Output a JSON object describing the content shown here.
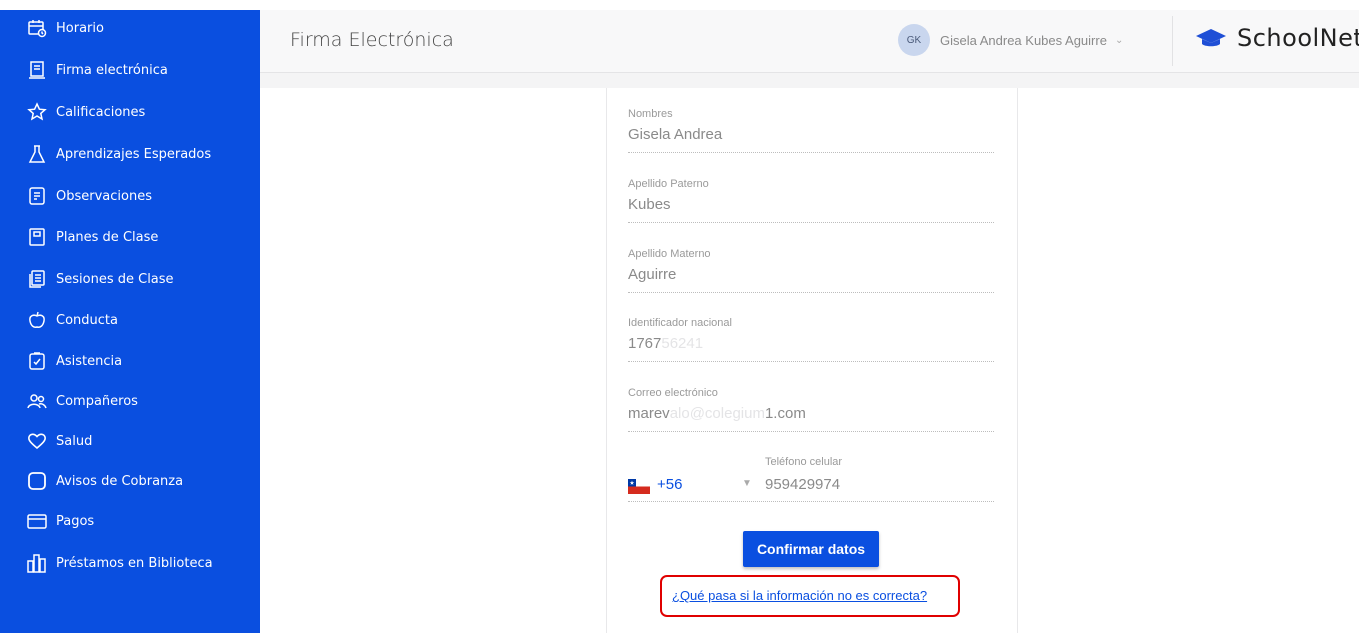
{
  "sidebar": {
    "items": [
      {
        "label": "Horario",
        "icon": "calendar-clock-icon"
      },
      {
        "label": "Firma electrónica",
        "icon": "document-sign-icon"
      },
      {
        "label": "Calificaciones",
        "icon": "star-icon"
      },
      {
        "label": "Aprendizajes Esperados",
        "icon": "flask-icon"
      },
      {
        "label": "Observaciones",
        "icon": "note-icon"
      },
      {
        "label": "Planes de Clase",
        "icon": "plan-icon"
      },
      {
        "label": "Sesiones de Clase",
        "icon": "sessions-icon"
      },
      {
        "label": "Conducta",
        "icon": "apple-icon"
      },
      {
        "label": "Asistencia",
        "icon": "attendance-icon"
      },
      {
        "label": "Compañeros",
        "icon": "people-icon"
      },
      {
        "label": "Salud",
        "icon": "heart-icon"
      },
      {
        "label": "Avisos de Cobranza",
        "icon": "square-icon"
      },
      {
        "label": "Pagos",
        "icon": "card-icon"
      },
      {
        "label": "Préstamos en Biblioteca",
        "icon": "books-icon"
      }
    ]
  },
  "header": {
    "title": "Firma Electrónica",
    "user_initials": "GK",
    "user_name": "Gisela Andrea Kubes Aguirre",
    "brand_name": "SchoolNet"
  },
  "form": {
    "fields": [
      {
        "label": "Nombres",
        "value": "Gisela Andrea"
      },
      {
        "label": "Apellido Paterno",
        "value": "Kubes"
      },
      {
        "label": "Apellido Materno",
        "value": "Aguirre"
      },
      {
        "label": "Identificador nacional",
        "value_visible": "1767",
        "value_blurred": "56241"
      },
      {
        "label": "Correo electrónico",
        "value_visible": "marev",
        "value_blurred": "alo@colegium",
        "value_suffix": "1.com"
      }
    ],
    "phone": {
      "dial_code": "+56",
      "label": "Teléfono celular",
      "value": "959429974"
    },
    "confirm_label": "Confirmar datos",
    "help_link": "¿Qué pasa si la información no es correcta?"
  },
  "colors": {
    "sidebar": "#0a4fe0",
    "accent": "#0a4fe0",
    "highlight_box": "#e00000"
  }
}
